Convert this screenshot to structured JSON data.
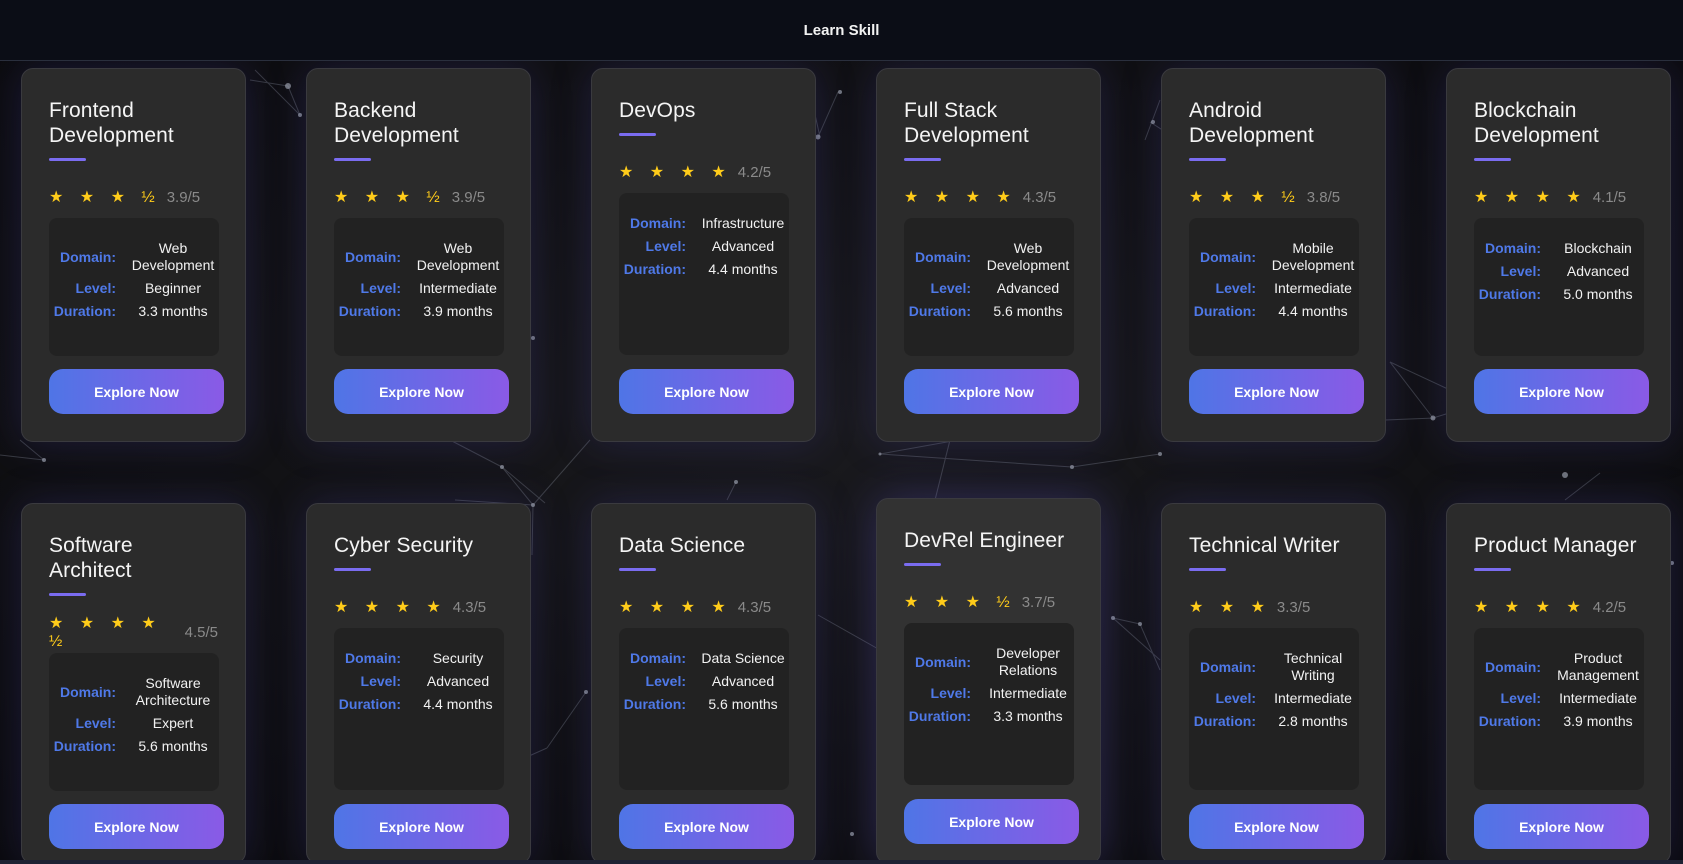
{
  "header": {
    "title": "Learn Skill"
  },
  "labels": {
    "domain": "Domain:",
    "level": "Level:",
    "duration": "Duration:"
  },
  "colors": {
    "accent_blue": "#4f75e6",
    "accent_purple": "#8a5ae6",
    "star": "#ffcc1a",
    "background": "#0d0e13"
  },
  "cards": [
    {
      "title": "Frontend Development",
      "stars": "★ ★ ★ ½",
      "score": "3.9/5",
      "domain": "Web Development",
      "level": "Beginner",
      "duration": "3.3 months",
      "button": "Explore Now"
    },
    {
      "title": "Backend Development",
      "stars": "★ ★ ★ ½",
      "score": "3.9/5",
      "domain": "Web Development",
      "level": "Intermediate",
      "duration": "3.9 months",
      "button": "Explore Now"
    },
    {
      "title": "DevOps",
      "stars": "★ ★ ★ ★",
      "score": "4.2/5",
      "domain": "Infrastructure",
      "level": "Advanced",
      "duration": "4.4 months",
      "button": "Explore Now"
    },
    {
      "title": "Full Stack Development",
      "stars": "★ ★ ★ ★",
      "score": "4.3/5",
      "domain": "Web Development",
      "level": "Advanced",
      "duration": "5.6 months",
      "button": "Explore Now"
    },
    {
      "title": "Android Development",
      "stars": "★ ★ ★ ½",
      "score": "3.8/5",
      "domain": "Mobile Development",
      "level": "Intermediate",
      "duration": "4.4 months",
      "button": "Explore Now"
    },
    {
      "title": "Blockchain Development",
      "stars": "★ ★ ★ ★",
      "score": "4.1/5",
      "domain": "Blockchain",
      "level": "Advanced",
      "duration": "5.0 months",
      "button": "Explore Now"
    },
    {
      "title": "Software Architect",
      "stars": "★ ★ ★ ★ ½",
      "score": "4.5/5",
      "domain": "Software Architecture",
      "level": "Expert",
      "duration": "5.6 months",
      "button": "Explore Now"
    },
    {
      "title": "Cyber Security",
      "stars": "★ ★ ★ ★",
      "score": "4.3/5",
      "domain": "Security",
      "level": "Advanced",
      "duration": "4.4 months",
      "button": "Explore Now"
    },
    {
      "title": "Data Science",
      "stars": "★ ★ ★ ★",
      "score": "4.3/5",
      "domain": "Data Science",
      "level": "Advanced",
      "duration": "5.6 months",
      "button": "Explore Now"
    },
    {
      "title": "DevRel Engineer",
      "stars": "★ ★ ★ ½",
      "score": "3.7/5",
      "domain": "Developer Relations",
      "level": "Intermediate",
      "duration": "3.3 months",
      "button": "Explore Now"
    },
    {
      "title": "Technical Writer",
      "stars": "★ ★ ★",
      "score": "3.3/5",
      "domain": "Technical Writing",
      "level": "Intermediate",
      "duration": "2.8 months",
      "button": "Explore Now"
    },
    {
      "title": "Product Manager",
      "stars": "★ ★ ★ ★",
      "score": "4.2/5",
      "domain": "Product Management",
      "level": "Intermediate",
      "duration": "3.9 months",
      "button": "Explore Now"
    }
  ]
}
